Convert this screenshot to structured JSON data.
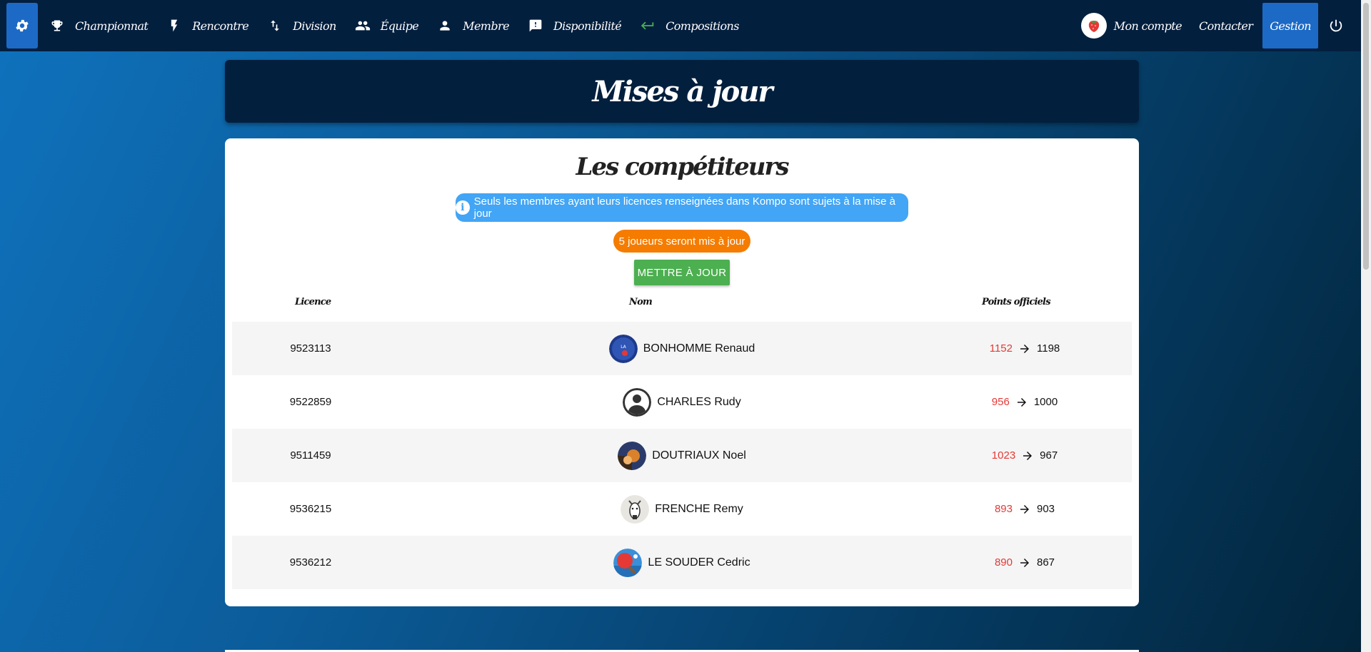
{
  "nav": {
    "items": [
      {
        "label": "Championnat",
        "icon": "trophy-icon"
      },
      {
        "label": "Rencontre",
        "icon": "lightning-icon"
      },
      {
        "label": "Division",
        "icon": "swap-vertical-icon"
      },
      {
        "label": "Équipe",
        "icon": "group-icon"
      },
      {
        "label": "Membre",
        "icon": "person-icon"
      },
      {
        "label": "Disponibilité",
        "icon": "feedback-icon"
      },
      {
        "label": "Compositions",
        "icon": "return-arrow-icon"
      }
    ],
    "account_label": "Mon compte",
    "contact_label": "Contacter",
    "gestion_label": "Gestion"
  },
  "page": {
    "title": "Mises à jour",
    "section_title": "Les compétiteurs",
    "info_message": "Seuls les membres ayant leurs licences renseignées dans Kompo sont sujets à la mise à jour",
    "count_message": "5 joueurs seront mis à jour",
    "update_button": "METTRE À JOUR"
  },
  "table": {
    "headers": {
      "licence": "Licence",
      "nom": "Nom",
      "points": "Points officiels"
    },
    "rows": [
      {
        "licence": "9523113",
        "nom": "BONHOMME Renaud",
        "old": "1152",
        "new": "1198",
        "avatar": "club-logo"
      },
      {
        "licence": "9522859",
        "nom": "CHARLES Rudy",
        "old": "956",
        "new": "1000",
        "avatar": "default-user"
      },
      {
        "licence": "9511459",
        "nom": "DOUTRIAUX Noel",
        "old": "1023",
        "new": "967",
        "avatar": "photo"
      },
      {
        "licence": "9536215",
        "nom": "FRENCHE Remy",
        "old": "893",
        "new": "903",
        "avatar": "goat"
      },
      {
        "licence": "9536212",
        "nom": "LE SOUDER Cedric",
        "old": "890",
        "new": "867",
        "avatar": "ping-pong"
      }
    ]
  },
  "colors": {
    "nav_bg": "#031f3e",
    "accent": "#1c6ac6",
    "old_points": "#e53935",
    "info": "#42a5f5",
    "count": "#f57c00",
    "update": "#4caf50"
  }
}
